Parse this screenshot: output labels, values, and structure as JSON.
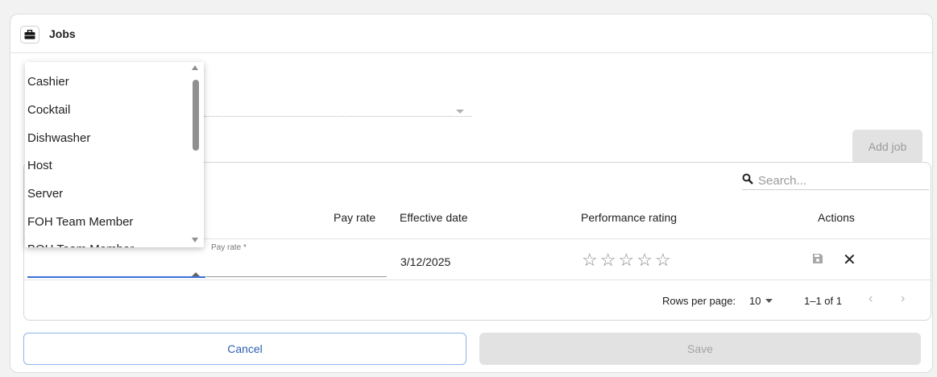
{
  "header": {
    "title": "Jobs",
    "icon": "briefcase-icon"
  },
  "toolbar": {
    "add_job_label": "Add job"
  },
  "table": {
    "search_placeholder": "Search...",
    "columns": [
      "Pay rate",
      "Effective date",
      "Performance rating",
      "Actions"
    ],
    "edit_row": {
      "pay_rate_label": "Pay rate *",
      "effective_date": "3/12/2025",
      "rating": 0,
      "rating_max": 5
    },
    "footer": {
      "rows_per_page_label": "Rows per page:",
      "rows_per_page_value": "10",
      "range": "1–1 of 1"
    }
  },
  "role_dropdown": {
    "options": [
      "Cashier",
      "Cocktail",
      "Dishwasher",
      "Host",
      "Server",
      "FOH Team Member",
      "BOH Team Member"
    ]
  },
  "actions": {
    "cancel_label": "Cancel",
    "save_label": "Save"
  },
  "colors": {
    "accent": "#3a6fd8",
    "cancel_text": "#2f5fb4",
    "disabled_bg": "#e2e2e2"
  }
}
